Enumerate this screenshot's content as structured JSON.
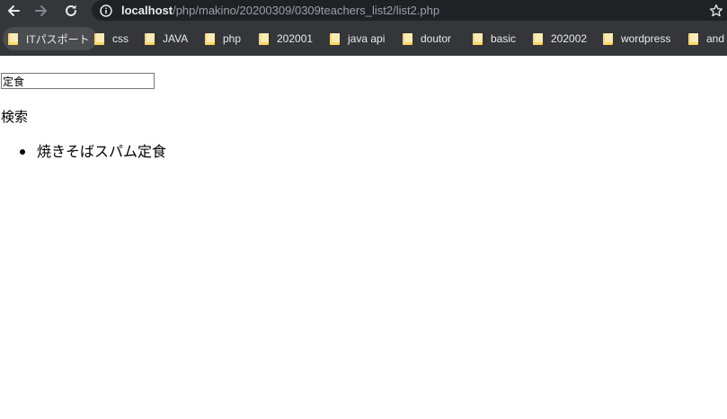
{
  "browser": {
    "url_host": "localhost",
    "url_path": "/php/makino/20200309/0309teachers_list2/list2.php",
    "bookmarks": [
      {
        "label": "ITパスポート"
      },
      {
        "label": "css"
      },
      {
        "label": "JAVA"
      },
      {
        "label": "php"
      },
      {
        "label": "202001"
      },
      {
        "label": "java api"
      },
      {
        "label": "doutor"
      },
      {
        "label": "basic"
      },
      {
        "label": "202002"
      },
      {
        "label": "wordpress"
      },
      {
        "label": "and"
      }
    ]
  },
  "page": {
    "search_value": "定食",
    "search_label": "検索",
    "results": [
      "焼きそばスパム定食"
    ]
  },
  "colors": {
    "chrome_bg": "#35363a",
    "omnibox_bg": "#202124",
    "folder": "#fdd663"
  }
}
